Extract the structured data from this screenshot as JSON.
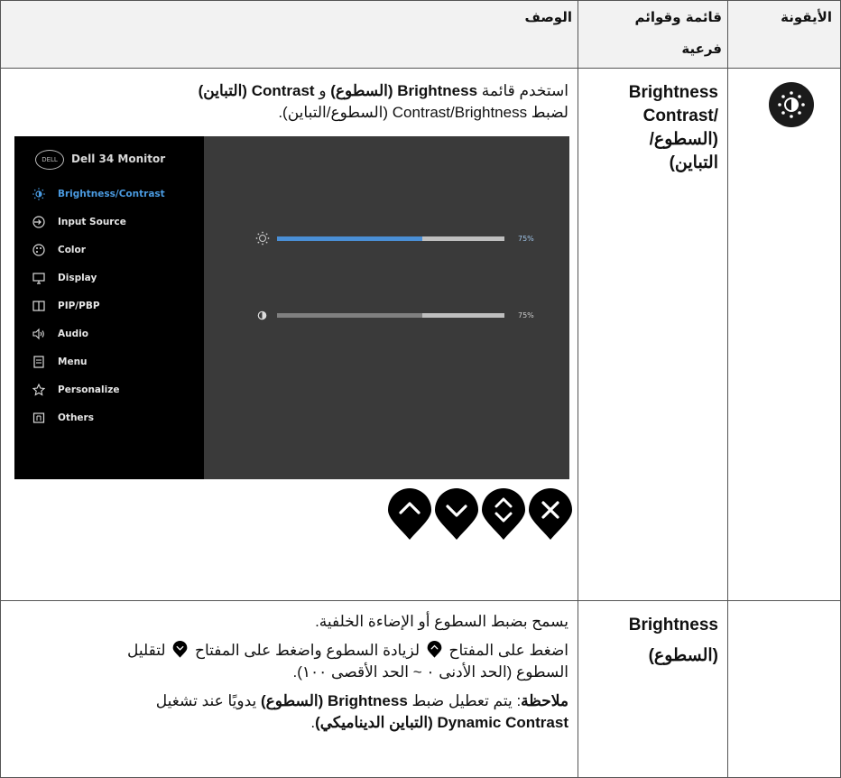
{
  "headers": {
    "icon": "الأيقونة",
    "menu_line1": "قائمة وقوائم",
    "menu_line2": "فرعية",
    "desc": "الوصف"
  },
  "row1": {
    "icon_name": "brightness-contrast-icon",
    "menu_l1": "Brightness",
    "menu_l2": "/Contrast",
    "menu_l3": "(السطوع/",
    "menu_l4": "التباين)",
    "desc_p1": {
      "t1": "استخدم قائمة ",
      "b1": "Brightness (السطوع)",
      "t2": " و ",
      "b2": "Contrast (التباين)",
      "t3": "لضبط Contrast/Brightness (السطوع/التباين)."
    }
  },
  "osd": {
    "logo": "DELL",
    "title": "Dell 34 Monitor",
    "items": [
      {
        "label": "Brightness/Contrast",
        "icon": "sun-icon",
        "active": true
      },
      {
        "label": "Input Source",
        "icon": "input-source-icon"
      },
      {
        "label": "Color",
        "icon": "palette-icon"
      },
      {
        "label": "Display",
        "icon": "monitor-icon"
      },
      {
        "label": "PIP/PBP",
        "icon": "pip-icon"
      },
      {
        "label": "Audio",
        "icon": "speaker-icon"
      },
      {
        "label": "Menu",
        "icon": "menu-icon"
      },
      {
        "label": "Personalize",
        "icon": "star-icon"
      },
      {
        "label": "Others",
        "icon": "others-icon"
      }
    ],
    "brightness_pct": "75%",
    "brightness_fill": 0.64,
    "contrast_pct": "75%",
    "contrast_fill": 0.64,
    "accent": "#4a8fd6",
    "buttons": [
      "up-arrow-icon",
      "down-arrow-icon",
      "up-down-icon",
      "close-icon"
    ]
  },
  "row2": {
    "menu_l1": "Brightness",
    "menu_l2": "(السطوع)",
    "line1": "يسمح بضبط السطوع أو الإضاءة الخلفية.",
    "line2a": "اضغط على المفتاح ",
    "line2b": " لزيادة السطوع واضغط على المفتاح ",
    "line2c": " لتقليل",
    "line3": "السطوع (الحد الأدنى ٠ ~ الحد الأقصى ١٠٠).",
    "note_label": "ملاحظة",
    "note_t1": ": يتم تعطيل ضبط ",
    "note_b1": "Brightness (السطوع)",
    "note_t2": " يدويًا عند تشغيل",
    "note_b2": "Dynamic Contrast (التباين الديناميكي)",
    "note_t3": "."
  }
}
